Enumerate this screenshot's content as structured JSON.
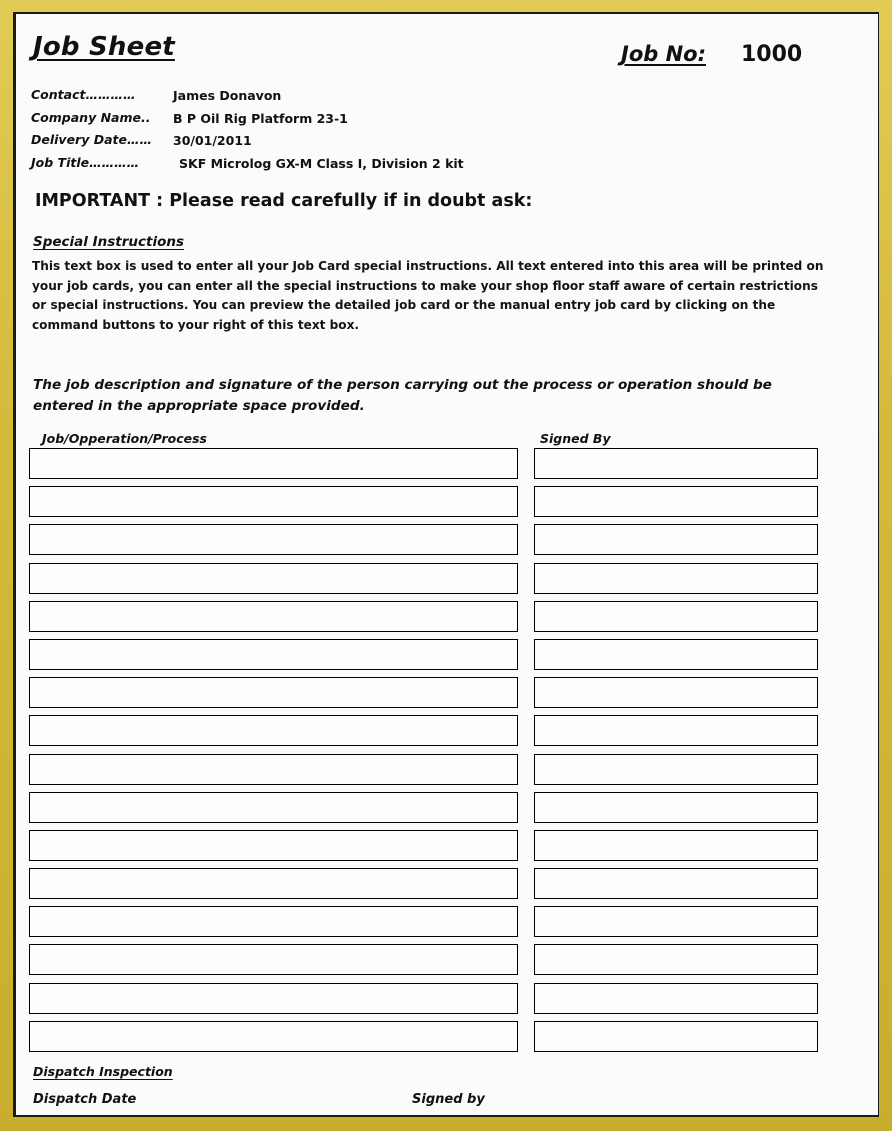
{
  "document": {
    "title": "Job Sheet",
    "job_no_label": "Job No:",
    "job_no_value": "1000"
  },
  "meta": {
    "rows": [
      {
        "label": "Contact…………",
        "value": "James Donavon"
      },
      {
        "label": "Company Name..",
        "value": "B P Oil Rig Platform 23-1"
      },
      {
        "label": "Delivery Date……",
        "value": "30/01/2011"
      },
      {
        "label": "Job Title…………",
        "value": "SKF Microlog GX-M Class I, Division 2 kit"
      }
    ]
  },
  "important": {
    "text": "IMPORTANT : Please read carefully if in doubt ask:"
  },
  "special_instructions": {
    "heading": "Special Instructions",
    "body": "This text box is used to enter all your Job Card special instructions. All text entered into this area will be printed on your job cards, you can enter all the special instructions to make your shop floor staff aware of certain restrictions or special instructions. You can preview the detailed job card or the manual entry job card by clicking on the command buttons to your right of this text box."
  },
  "job_description_note": {
    "text": "The job description and signature of the person carrying out the process or operation should be entered in the appropriate space provided."
  },
  "table": {
    "columns": [
      {
        "header": "Job/Opperation/Process"
      },
      {
        "header": "Signed By"
      }
    ],
    "rows": [
      {
        "job": "",
        "signed_by": ""
      },
      {
        "job": "",
        "signed_by": ""
      },
      {
        "job": "",
        "signed_by": ""
      },
      {
        "job": "",
        "signed_by": ""
      },
      {
        "job": "",
        "signed_by": ""
      },
      {
        "job": "",
        "signed_by": ""
      },
      {
        "job": "",
        "signed_by": ""
      },
      {
        "job": "",
        "signed_by": ""
      },
      {
        "job": "",
        "signed_by": ""
      },
      {
        "job": "",
        "signed_by": ""
      },
      {
        "job": "",
        "signed_by": ""
      },
      {
        "job": "",
        "signed_by": ""
      },
      {
        "job": "",
        "signed_by": ""
      },
      {
        "job": "",
        "signed_by": ""
      },
      {
        "job": "",
        "signed_by": ""
      },
      {
        "job": "",
        "signed_by": ""
      }
    ]
  },
  "dispatch": {
    "heading": "Dispatch Inspection",
    "date_label": "Dispatch Date",
    "signed_label": "Signed by"
  },
  "colors": {
    "frame": "#d4b93a",
    "frame_inner_line": "#1b1b18",
    "paper": "#fbfbfb",
    "text": "#111111",
    "box_border": "#000000"
  }
}
